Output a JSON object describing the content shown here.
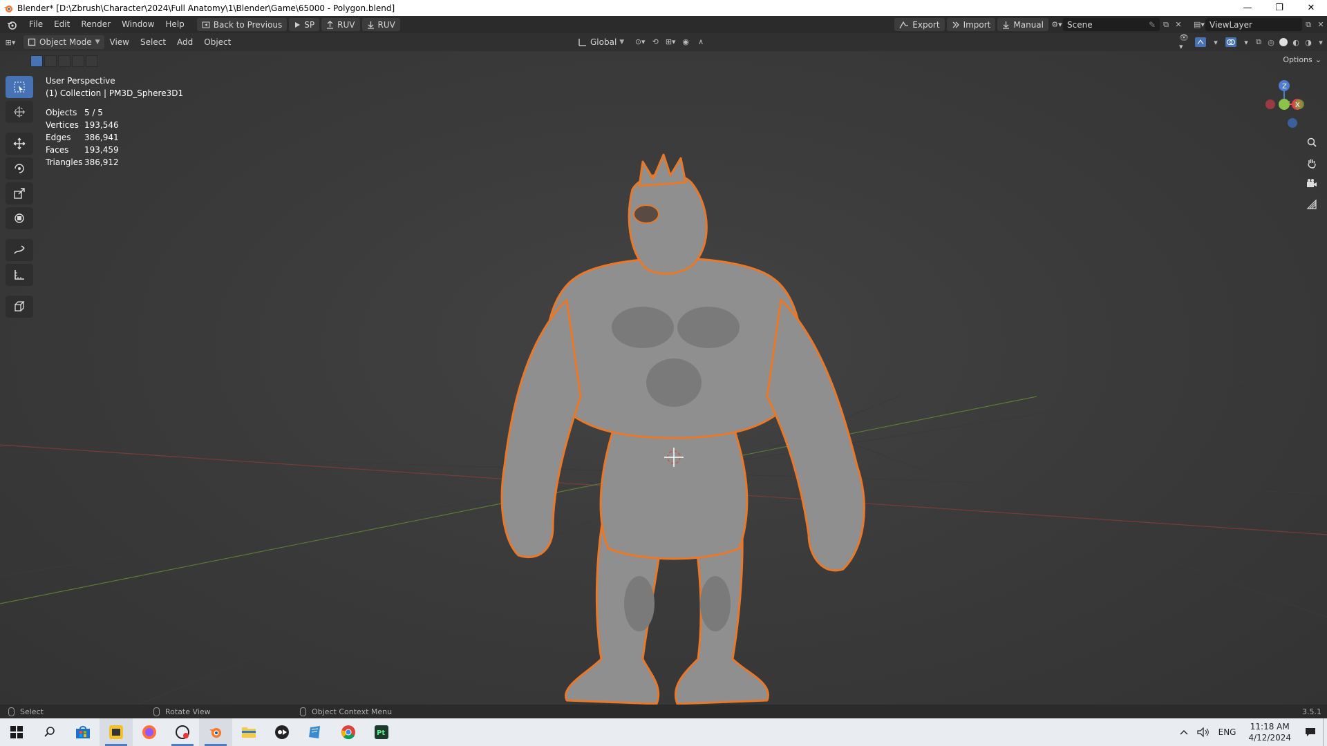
{
  "window": {
    "title": "Blender* [D:\\Zbrush\\Character\\2024\\Full Anatomy\\1\\Blender\\Game\\65000 - Polygon.blend]",
    "controls": [
      "—",
      "❐",
      "✕"
    ]
  },
  "topbar": {
    "menus": [
      "File",
      "Edit",
      "Render",
      "Window",
      "Help"
    ],
    "buttons": {
      "back": "Back to Previous",
      "sp": "SP",
      "ruv_up": "RUV",
      "ruv_down": "RUV"
    },
    "right": {
      "export": "Export",
      "import": "Import",
      "manual": "Manual",
      "scene": "Scene",
      "view_layer": "ViewLayer"
    }
  },
  "viewport_header": {
    "mode": "Object Mode",
    "menus": [
      "View",
      "Select",
      "Add",
      "Object"
    ],
    "transform_orientation": "Global",
    "options": "Options"
  },
  "overlay": {
    "view_name": "User Perspective",
    "collection": "(1) Collection | PM3D_Sphere3D1",
    "stats": [
      {
        "label": "Objects",
        "value": "5 / 5"
      },
      {
        "label": "Vertices",
        "value": "193,546"
      },
      {
        "label": "Edges",
        "value": "386,941"
      },
      {
        "label": "Faces",
        "value": "193,459"
      },
      {
        "label": "Triangles",
        "value": "386,912"
      }
    ]
  },
  "toolbar": {
    "tools": [
      "select-box-icon",
      "cursor-icon",
      "move-icon",
      "rotate-icon",
      "scale-icon",
      "transform-icon",
      "annotate-icon",
      "measure-icon",
      "add-cube-icon"
    ]
  },
  "gizmo": {
    "axes": [
      "X",
      "Y",
      "Z"
    ]
  },
  "statusbar": {
    "select": "Select",
    "rotate": "Rotate View",
    "context": "Object Context Menu",
    "version": "3.5.1"
  },
  "taskbar": {
    "language": "ENG",
    "time": "11:18 AM",
    "date": "4/12/2024"
  },
  "colors": {
    "selection_outline": "#e8782a",
    "mesh": "#9a9a9a",
    "accent": "#4772b3"
  }
}
